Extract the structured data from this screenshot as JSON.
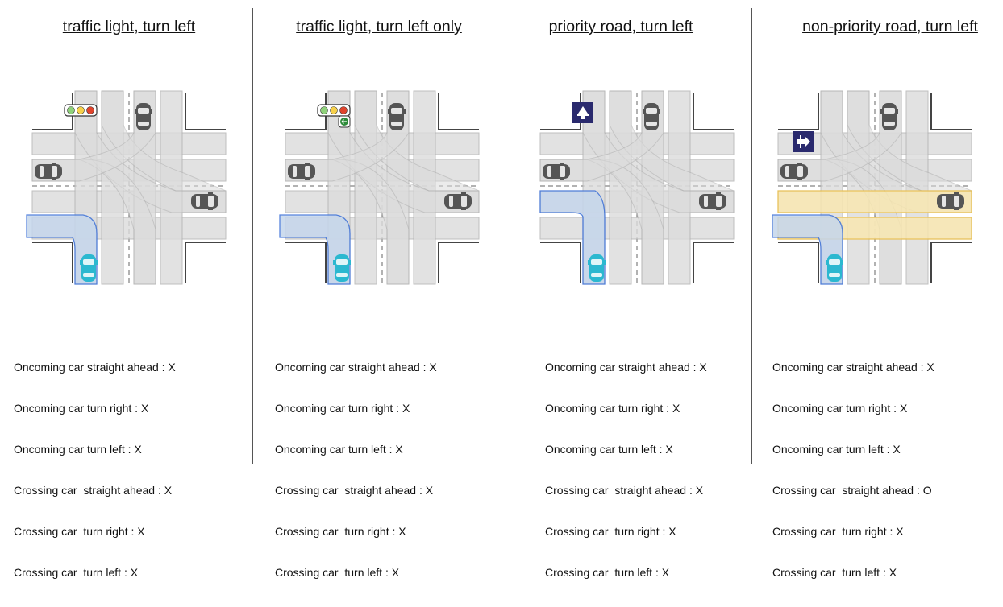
{
  "panels": [
    {
      "title": "traffic light, turn left",
      "sign": "traffic-light",
      "rules": [
        "Oncoming car straight ahead : X",
        "Oncoming car turn right : X",
        "Oncoming car turn left : X",
        "Crossing car  straight ahead : X",
        "Crossing car  turn right : X",
        "Crossing car  turn left : X"
      ]
    },
    {
      "title": "traffic light, turn left only",
      "sign": "traffic-light-left-arrow",
      "rules": [
        "Oncoming car straight ahead : X",
        "Oncoming car turn right : X",
        "Oncoming car turn left : X",
        "Crossing car  straight ahead : X",
        "Crossing car  turn right : X",
        "Crossing car  turn left : X"
      ]
    },
    {
      "title": "priority road, turn left",
      "sign": "priority-road-sign",
      "rules": [
        "Oncoming car straight ahead : X",
        "Oncoming car turn right : X",
        "Oncoming car turn left : X",
        "Crossing car  straight ahead : X",
        "Crossing car  turn right : X",
        "Crossing car  turn left : X"
      ]
    },
    {
      "title": "non-priority road, turn left",
      "sign": "side-road-sign",
      "rules": [
        "Oncoming car straight ahead : X",
        "Oncoming car turn right : X",
        "Oncoming car turn left : X",
        "Crossing car  straight ahead : O",
        "Crossing car  turn right : X",
        "Crossing car  turn left : X"
      ]
    }
  ],
  "colors": {
    "lane_gray": "#dcdcdc",
    "lane_stroke": "#b0b0b0",
    "ego_path_fill": "#c5d6ec",
    "ego_path_stroke": "#3a6fd8",
    "conflict_fill": "#fbe9b0",
    "conflict_stroke": "#f0c040",
    "ego_car": "#2bb8d0",
    "other_car": "#555555",
    "sign_blue": "#2a2a6e"
  }
}
